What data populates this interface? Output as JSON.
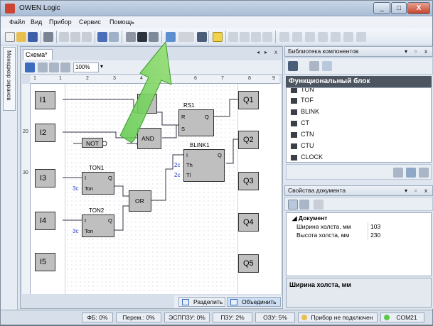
{
  "window": {
    "title": "OWEN Logic",
    "min": "_",
    "max": "□",
    "close": "X"
  },
  "menu": [
    "Файл",
    "Вид",
    "Прибор",
    "Сервис",
    "Помощь"
  ],
  "side_tab": {
    "label": "Менеджер экранов"
  },
  "doc": {
    "tab": "Схема*",
    "controls": [
      "◂",
      "▸",
      "x"
    ],
    "zoom": "100%",
    "ruler_top": [
      "1",
      "1",
      "2",
      "3",
      "4",
      "5",
      "6",
      "7",
      "8",
      "9"
    ],
    "ruler_left": [
      "20",
      "30"
    ],
    "split_label": "Разделить",
    "merge_label": "Объединить"
  },
  "scheme": {
    "inputs": [
      "I1",
      "I2",
      "I3",
      "I4",
      "I5"
    ],
    "outputs": [
      "Q1",
      "Q2",
      "Q3",
      "Q4",
      "Q5"
    ],
    "rs1": {
      "title": "RS1",
      "pins": [
        "R",
        "S",
        "Q"
      ]
    },
    "and": "AND",
    "not": "NOT",
    "blink1": {
      "title": "BLINK1",
      "pins": [
        "I",
        "Th",
        "Tl",
        "Q"
      ],
      "params": [
        "2с",
        "2с"
      ]
    },
    "ton1": {
      "title": "TON1",
      "pins": [
        "I",
        "Ton",
        "Q"
      ],
      "param": "3с"
    },
    "ton2": {
      "title": "TON2",
      "pins": [
        "I",
        "Ton",
        "Q"
      ],
      "param": "3с"
    },
    "or": "OR"
  },
  "library": {
    "title": "Библиотека компонентов",
    "category": "Функциональный блок",
    "items": [
      "TON",
      "TOF",
      "BLINK",
      "CT",
      "CTN",
      "CTU",
      "CLOCK"
    ]
  },
  "properties": {
    "title": "Свойства документа",
    "group": "Документ",
    "rows": [
      {
        "name": "Ширина холста, мм",
        "value": "103"
      },
      {
        "name": "Высота холста, мм",
        "value": "230"
      }
    ],
    "description": "Ширина холста, мм"
  },
  "status": {
    "fb": "ФБ: 0%",
    "perem": "Перем.: 0%",
    "eeprom": "ЭСППЗУ: 0%",
    "pzu": "ПЗУ: 2%",
    "ozu": "ОЗУ: 5%",
    "device": "Прибор не подключен",
    "port": "COM21"
  },
  "colors": {
    "arrow": "#5cc84a",
    "block": "#bfbfbf",
    "param": "#2a40c8"
  }
}
